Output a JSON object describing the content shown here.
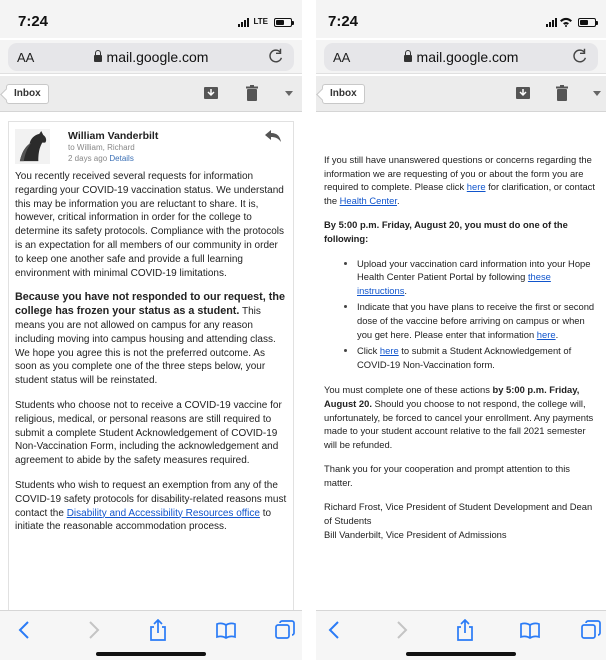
{
  "left": {
    "status": {
      "time": "7:24",
      "network": "LTE"
    },
    "browser": {
      "aa": "AA",
      "url": "mail.google.com"
    },
    "gmail": {
      "inbox_label": "Inbox"
    },
    "sender": {
      "name": "William Vanderbilt",
      "to": "to William, Richard",
      "date": "2 days ago",
      "details": "Details"
    },
    "paragraphs": {
      "p1": "You recently received several requests for information regarding your COVID-19 vaccination status. We understand this may be information you are reluctant to share. It is, however, critical information in order for the college to determine its safety protocols. Compliance with the protocols is an expectation for all members of our community in order to keep one another safe and provide a full learning environment with minimal COVID-19 limitations.",
      "p2_bold": "Because you have not responded to our request, the college has frozen your status as a student.",
      "p2_rest": " This means you are not allowed on campus for any reason including moving into campus housing and attending class. We hope you agree this is not the preferred outcome. As soon as you complete one of the three steps below, your student status will be reinstated.",
      "p3": "Students who choose not to receive a COVID-19 vaccine for religious, medical, or personal reasons are still required to submit a complete Student Acknowledgement of COVID-19 Non-Vaccination Form, including the acknowledgement and agreement to abide by the safety measures required.",
      "p4_start": "Students who wish to request an exemption from any of the COVID-19 safety protocols for disability-related reasons must contact the ",
      "p4_link": "Disability and Accessibility Resources office",
      "p4_end": " to initiate the reasonable accommodation process."
    }
  },
  "right": {
    "status": {
      "time": "7:24"
    },
    "browser": {
      "aa": "AA",
      "url": "mail.google.com"
    },
    "gmail": {
      "inbox_label": "Inbox"
    },
    "p1_start": "If you still have unanswered questions or concerns regarding the information we are requesting of you or about the form you are required to complete. Please click ",
    "p1_link1": "here",
    "p1_mid": " for clarification, or contact the ",
    "p1_link2": "Health Center",
    "p1_end": ".",
    "heading": "By 5:00 p.m. Friday, August 20, you must do one of the following:",
    "bullets": {
      "b1_text": "Upload your vaccination card information into your Hope Health Center Patient Portal by following ",
      "b1_link": "these instructions",
      "b1_end": ".",
      "b2_text": "Indicate that you have plans to receive the first or second dose of the vaccine before arriving on campus or when you get here. Please enter that information ",
      "b2_link": "here",
      "b2_end": ".",
      "b3_start": "Click ",
      "b3_link": "here",
      "b3_text": " to submit a Student Acknowledgement of COVID-19 Non-Vaccination form."
    },
    "p2_start": "You must complete one of these actions ",
    "p2_bold": "by 5:00 p.m. Friday, August 20.",
    "p2_rest": " Should you choose to not respond, the college will, unfortunately, be forced to cancel your enrollment. Any payments made to your student account relative to the fall 2021 semester will be refunded.",
    "p3": "Thank you for your cooperation and prompt attention to this matter.",
    "sig1": "Richard Frost, Vice President of Student Development and Dean of Students",
    "sig2": "Bill Vanderbilt, Vice President of Admissions"
  }
}
